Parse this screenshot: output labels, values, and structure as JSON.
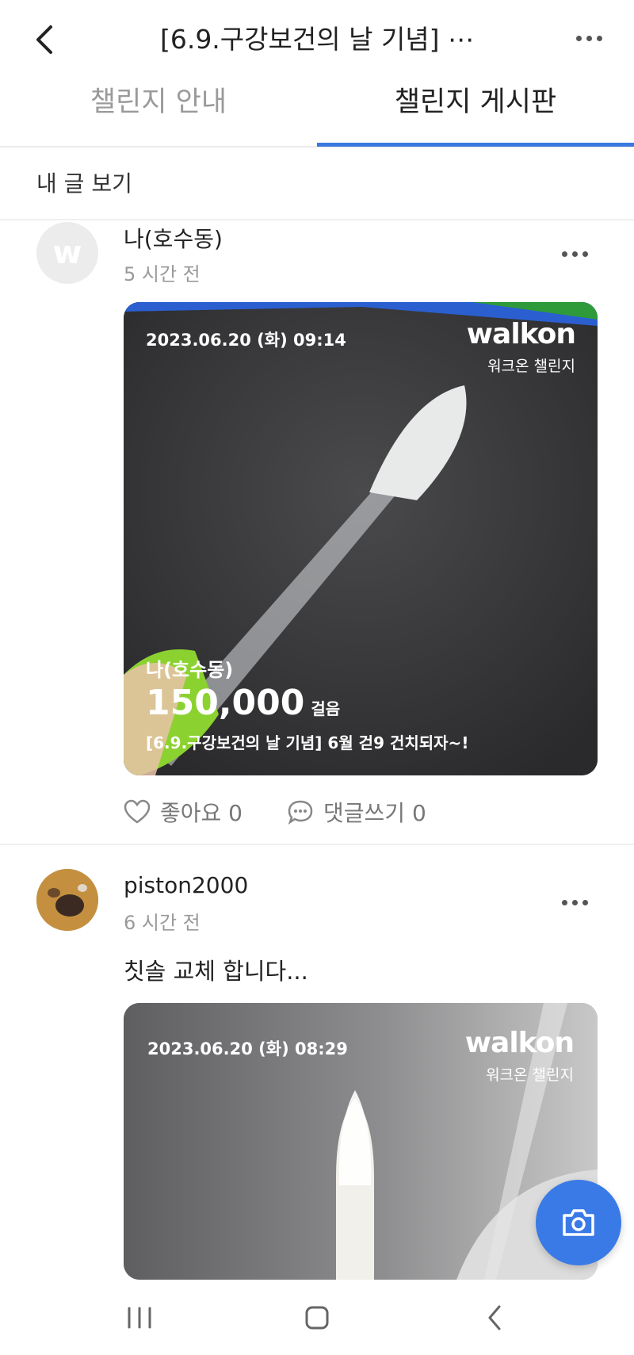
{
  "header": {
    "title": "[6.9.구강보건의 날 기념] ⋯",
    "icons": {
      "back": "chevron-left-icon",
      "more": "more-horizontal-icon"
    }
  },
  "tabs": [
    {
      "label": "챌린지 안내",
      "active": false
    },
    {
      "label": "챌린지 게시판",
      "active": true
    }
  ],
  "my_posts_label": "내 글 보기",
  "posts": [
    {
      "avatar_letter": "w",
      "author": "나(호수동)",
      "time": "5 시간 전",
      "photo": {
        "date": "2023.06.20 (화) 09:14",
        "brand": "walkon",
        "brand_sub": "워크온 챌린지",
        "overlay_name": "나(호수동)",
        "overlay_steps": "150,000",
        "overlay_steps_unit": "걸음",
        "overlay_challenge": "[6.9.구강보건의 날 기념] 6월 걷9 건치되자~!"
      },
      "like_label": "좋아요 0",
      "comment_label": "댓글쓰기 0"
    },
    {
      "author": "piston2000",
      "time": "6 시간 전",
      "caption": "칫솔 교체 합니다...",
      "photo": {
        "date": "2023.06.20 (화) 08:29",
        "brand": "walkon",
        "brand_sub": "워크온 챌린지"
      }
    }
  ],
  "fab": {
    "icon": "camera-icon"
  },
  "system_nav": {
    "icons": [
      "recent-apps-icon",
      "home-icon",
      "back-icon"
    ]
  },
  "colors": {
    "accent": "#3a78e0",
    "fab": "#3a7ae6"
  }
}
